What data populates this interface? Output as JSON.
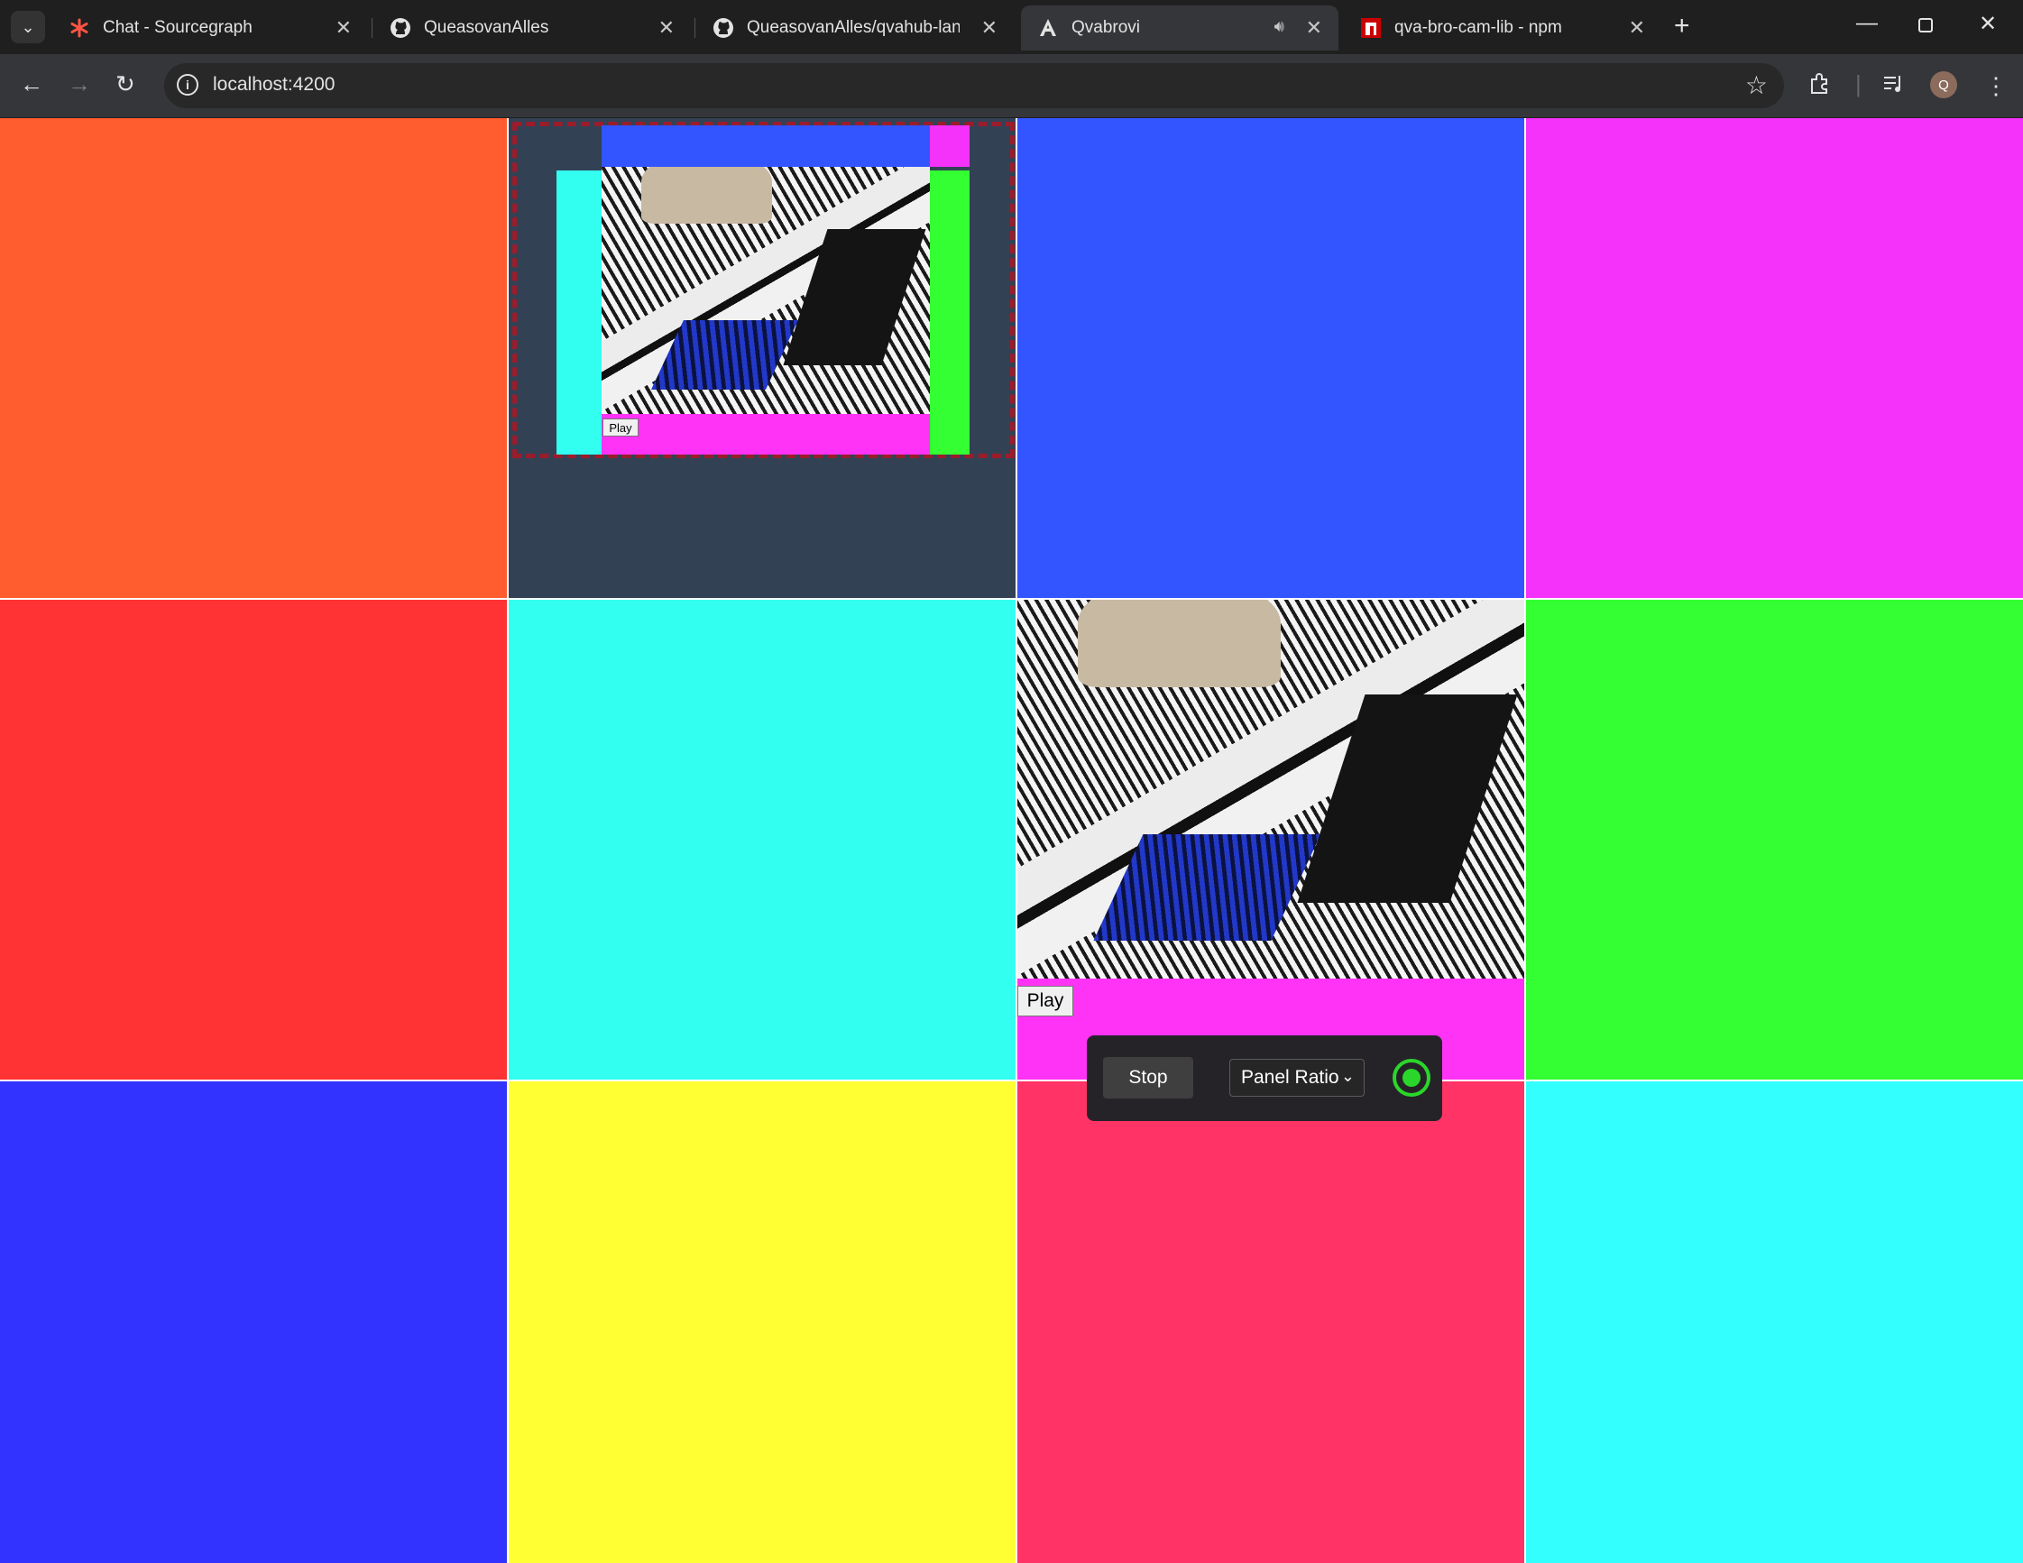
{
  "browser": {
    "tabs": [
      {
        "label": "Chat - Sourcegraph",
        "icon": "sourcegraph-icon",
        "active": false
      },
      {
        "label": "QueasovanAlles",
        "icon": "github-icon",
        "active": false
      },
      {
        "label": "QueasovanAlles/qvahub-lan-co",
        "icon": "github-icon",
        "active": false
      },
      {
        "label": "Qvabrovi",
        "icon": "angular-icon",
        "active": true,
        "audio": true
      },
      {
        "label": "qva-bro-cam-lib - npm",
        "icon": "npm-icon",
        "active": false
      }
    ],
    "url": "localhost:4200",
    "profile_initial": "Q"
  },
  "grid": {
    "columns": 4,
    "rows": 3,
    "cells": [
      {
        "color": "#ff5c30",
        "content": "empty"
      },
      {
        "color": "#334155",
        "content": "framed-camera"
      },
      {
        "color": "#3355ff",
        "content": "empty"
      },
      {
        "color": "#f432f9",
        "content": "empty"
      },
      {
        "color": "#ff3333",
        "content": "empty"
      },
      {
        "color": "#33fff1",
        "content": "empty"
      },
      {
        "color": "#ff33f5",
        "content": "camera"
      },
      {
        "color": "#33ff33",
        "content": "empty"
      },
      {
        "color": "#3333ff",
        "content": "empty"
      },
      {
        "color": "#ffff33",
        "content": "empty"
      },
      {
        "color": "#ff3366",
        "content": "empty"
      },
      {
        "color": "#33ffff",
        "content": "empty"
      }
    ]
  },
  "framed_camera": {
    "frame_colors": {
      "top": "#3355ff",
      "corner": "#f432f9",
      "left": "#33fff1",
      "right": "#33ff33",
      "bottom": "#ff33f5",
      "dashed_border": "#9b1c2a"
    },
    "play_label": "Play"
  },
  "camera": {
    "play_label": "Play"
  },
  "controls": {
    "stop_label": "Stop",
    "ratio_label": "Panel Ratio",
    "status_color": "#2bd62b"
  }
}
